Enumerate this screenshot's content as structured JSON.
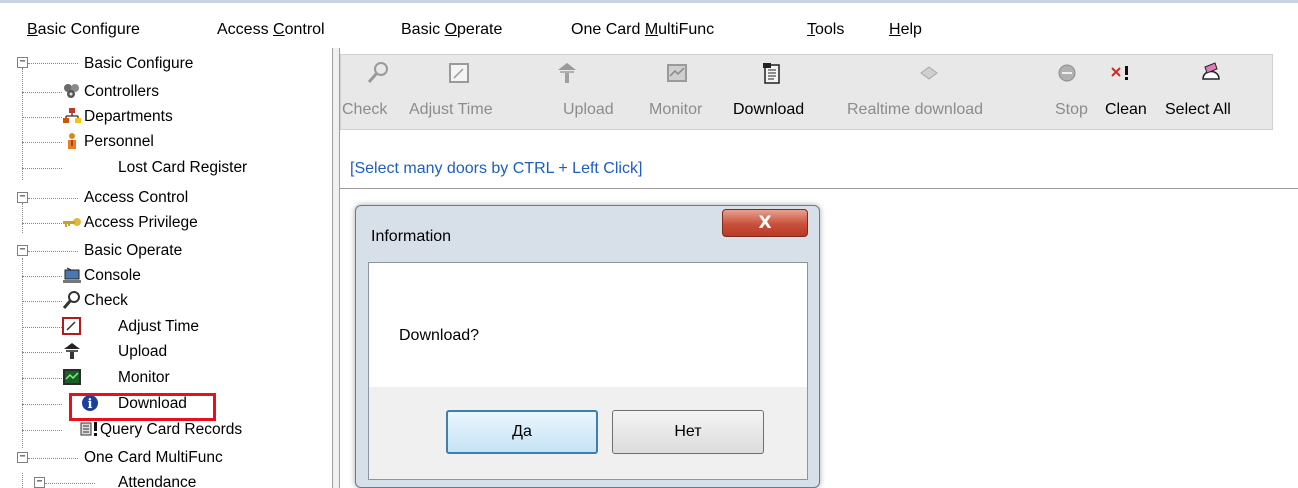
{
  "menubar": {
    "items": [
      {
        "pre": "",
        "accel": "B",
        "post": "asic Configure"
      },
      {
        "pre": "Access ",
        "accel": "C",
        "post": "ontrol"
      },
      {
        "pre": "Basic ",
        "accel": "O",
        "post": "perate"
      },
      {
        "pre": "One Card ",
        "accel": "M",
        "post": "ultiFunc"
      },
      {
        "pre": "",
        "accel": "T",
        "post": "ools"
      },
      {
        "pre": "",
        "accel": "H",
        "post": "elp"
      }
    ]
  },
  "tree": {
    "items": [
      {
        "label": "Basic Configure",
        "icon": "none"
      },
      {
        "label": "Controllers",
        "icon": "controllers-icon"
      },
      {
        "label": "Departments",
        "icon": "departments-icon"
      },
      {
        "label": "Personnel",
        "icon": "personnel-icon"
      },
      {
        "label": "Lost Card Register",
        "icon": "none"
      },
      {
        "label": "Access Control",
        "icon": "none"
      },
      {
        "label": "Access Privilege",
        "icon": "key-icon"
      },
      {
        "label": "Basic Operate",
        "icon": "none"
      },
      {
        "label": "Console",
        "icon": "console-icon"
      },
      {
        "label": "Check",
        "icon": "check-icon"
      },
      {
        "label": "Adjust Time",
        "icon": "adjust-time-icon"
      },
      {
        "label": "Upload",
        "icon": "upload-icon"
      },
      {
        "label": "Monitor",
        "icon": "monitor-icon"
      },
      {
        "label": "Download",
        "icon": "download-info-icon"
      },
      {
        "label": "Query Card Records",
        "icon": "query-records-icon"
      },
      {
        "label": "One Card MultiFunc",
        "icon": "none"
      },
      {
        "label": "Attendance",
        "icon": "none"
      }
    ]
  },
  "toolbar": {
    "buttons": [
      {
        "label": "Check",
        "enabled": false
      },
      {
        "label": "Adjust Time",
        "enabled": false
      },
      {
        "label": "Upload",
        "enabled": false
      },
      {
        "label": "Monitor",
        "enabled": false
      },
      {
        "label": "Download",
        "enabled": true
      },
      {
        "label": "Realtime download",
        "enabled": false
      },
      {
        "label": "Stop",
        "enabled": false
      },
      {
        "label": "Clean",
        "enabled": true
      },
      {
        "label": "Select All",
        "enabled": true
      }
    ]
  },
  "hint": "[Select many doors by CTRL + Left Click]",
  "dialog": {
    "title": "Information",
    "close_label": "X",
    "message": "Download?",
    "yes_label": "Да",
    "no_label": "Нет"
  },
  "colors": {
    "hint": "#1d5ebf",
    "highlight": "#e8101c",
    "toolbar_bg": "#e8e8e8",
    "dialog_frame": "#d7dfe9"
  }
}
